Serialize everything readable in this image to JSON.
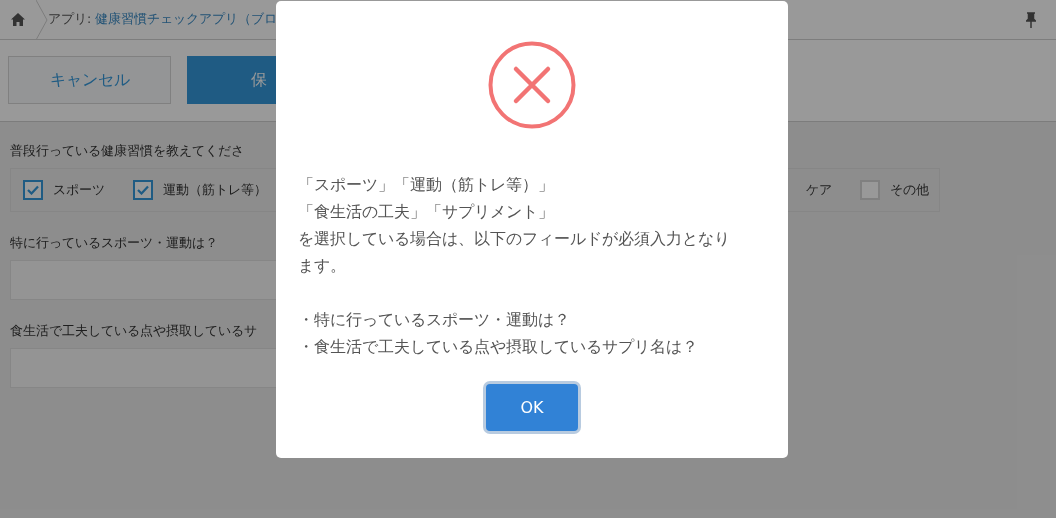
{
  "breadcrumb": {
    "prefix": "アプリ: ",
    "app_link": "健康習慣チェックアプリ（ブロ"
  },
  "toolbar": {
    "cancel": "キャンセル",
    "save": "保"
  },
  "form": {
    "habits_label": "普段行っている健康習慣を教えてくださ",
    "checkboxes": [
      {
        "label": "スポーツ",
        "checked": true
      },
      {
        "label": "運動（筋トレ等）",
        "checked": true
      }
    ],
    "right_partial_label": "ケア",
    "right_checkboxes": [
      {
        "label": "その他",
        "checked": false
      }
    ],
    "fields": [
      {
        "label": "特に行っているスポーツ・運動は？"
      },
      {
        "label": "食生活で工夫している点や摂取しているサ"
      }
    ]
  },
  "dialog": {
    "message_lines": [
      "「スポーツ」「運動（筋トレ等）」",
      "「食生活の工夫」「サプリメント」",
      "を選択している場合は、以下のフィールドが必須入力となります。"
    ],
    "bullets": [
      "・特に行っているスポーツ・運動は？",
      "・食生活で工夫している点や摂取しているサプリ名は？"
    ],
    "ok": "OK"
  }
}
